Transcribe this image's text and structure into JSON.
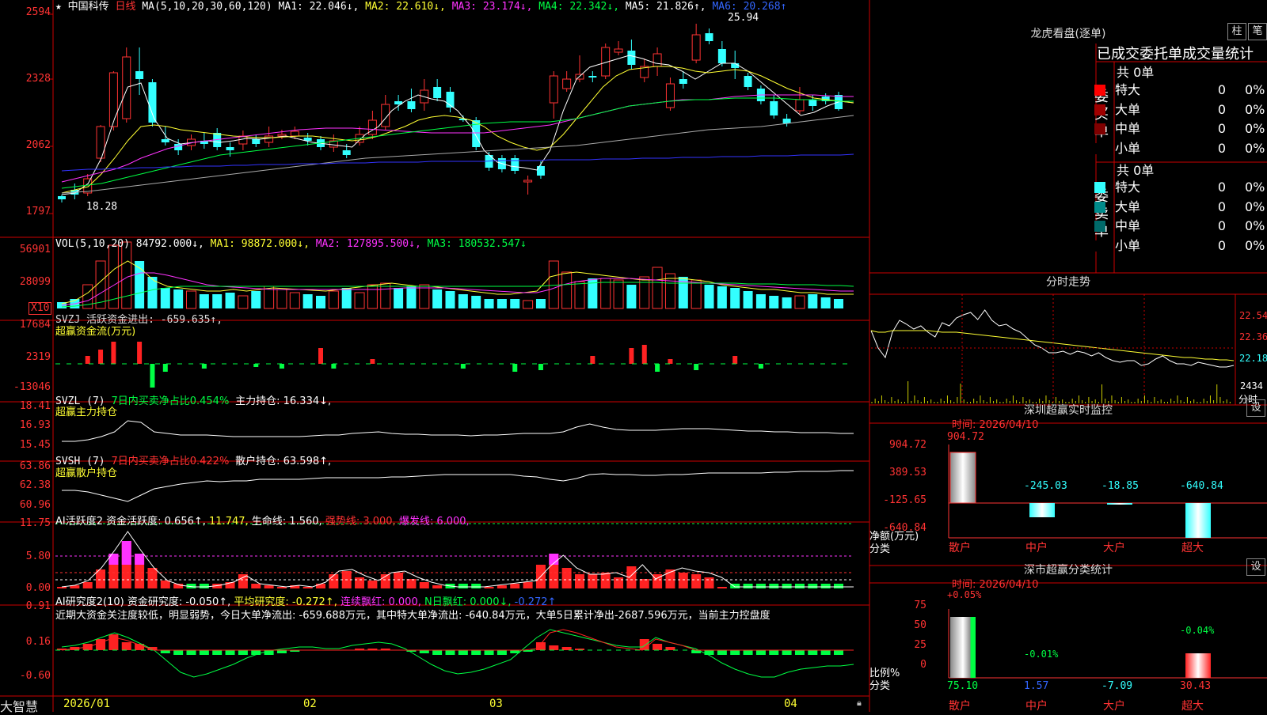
{
  "stock": {
    "name": "中国科传",
    "period": "日线",
    "ma_header": "MA(5,10,20,30,60,120)",
    "ma1": "MA1: 22.046↓,",
    "ma2": "MA2: 22.610↓,",
    "ma3": "MA3: 23.174↓,",
    "ma4": "MA4: 22.342↓,",
    "ma5": "MA5: 21.826↑,",
    "ma6": "MA6: 20.268↑",
    "high_label": "25.94",
    "low_label": "18.28"
  },
  "colors": {
    "red": "#ff3333",
    "cyan": "#33ffff",
    "green": "#00ff44",
    "yellow": "#ffff33",
    "magenta": "#ff33ff",
    "blue": "#3366ff",
    "frame": "#cc0000"
  },
  "price_axis": [
    "2594",
    "2328",
    "2062",
    "1797"
  ],
  "vol": {
    "header": "VOL(5,10,20)",
    "val": "84792.000↓,",
    "ma1": "MA1: 98872.000↓,",
    "ma2": "MA2: 127895.500↓,",
    "ma3": "MA3: 180532.547↓",
    "axis": [
      "56901",
      "28099"
    ],
    "unit": "X10"
  },
  "svzj": {
    "header": "SVZJ  活跃资金进出: -659.635↑,",
    "sub": "超赢资金流(万元)",
    "axis": [
      "17684",
      "2319",
      "-13046"
    ]
  },
  "svzl": {
    "header_a": "SVZL (7)",
    "header_b": "7日内买卖净占比0.454%",
    "header_c": "主力持仓: 16.334↓,",
    "sub": "超赢主力持仓",
    "axis": [
      "18.41",
      "16.93",
      "15.45"
    ]
  },
  "svsh": {
    "header_a": "SVSH (7)",
    "header_b": "7日内买卖净占比0.422%",
    "header_c": "散户持仓: 63.598↑,",
    "sub": "超赢散户持仓",
    "axis": [
      "63.86",
      "62.38",
      "60.96"
    ]
  },
  "ai2": {
    "header_a": "AI活跃度2 资金活跃度: 0.656↑,",
    "header_b": "11.747,",
    "header_c": "生命线: 1.560,",
    "header_d": "强势线: 3.000,",
    "header_e": "爆发线: 6.000,",
    "axis": [
      "11.75",
      "5.80",
      "0.00"
    ]
  },
  "ai_res": {
    "header_a": "AI研究度2(10) 资金研究度: -0.050↑,",
    "header_b": "平均研究度: -0.272↑,",
    "header_c": "连续飘红: 0.000,",
    "header_d": "N日飘红: 0.000↓,",
    "header_e": "-0.272↑",
    "comment": "近期大资金关注度较低，明显弱势，今日大单净流出: -659.688万元，其中特大单净流出: -640.84万元，大单5日累计净出-2687.596万元，当前主力控盘度",
    "axis": [
      "0.91",
      "0.16",
      "-0.60"
    ]
  },
  "dates": [
    "2026/01",
    "02",
    "03",
    "04"
  ],
  "brand": "大智慧",
  "right": {
    "dragon_title": "龙虎看盘(逐单)",
    "btn_bar": "柱",
    "btn_pen": "笔",
    "tab_title": "已成交委托单成交量统计",
    "buy_side": {
      "label": "委买单",
      "total": "共 0单",
      "rows": [
        {
          "name": "特大",
          "v": "0",
          "p": "0%"
        },
        {
          "name": "大单",
          "v": "0",
          "p": "0%"
        },
        {
          "name": "中单",
          "v": "0",
          "p": "0%"
        },
        {
          "name": "小单",
          "v": "0",
          "p": "0%"
        }
      ]
    },
    "sell_side": {
      "label": "委卖单",
      "total": "共 0单",
      "rows": [
        {
          "name": "特大",
          "v": "0",
          "p": "0%"
        },
        {
          "name": "大单",
          "v": "0",
          "p": "0%"
        },
        {
          "name": "中单",
          "v": "0",
          "p": "0%"
        },
        {
          "name": "小单",
          "v": "0",
          "p": "0%"
        }
      ]
    },
    "minute_title": "分时走势",
    "minute_axis": [
      "22.54",
      "22.36",
      "22.18"
    ],
    "minute_vol": "2434",
    "minute_vol_unit": "分时",
    "sz_title": "深圳超赢实时监控",
    "set": "设",
    "sz_time": "时间: 2026/04/10",
    "sz_axis": [
      "904.72",
      "389.53",
      "-125.65",
      "-640.84"
    ],
    "sz_unit_a": "净额(万元)",
    "sz_unit_b": "分类",
    "sz_bars": [
      {
        "cat": "散户",
        "val": "904.72"
      },
      {
        "cat": "中户",
        "val": "-245.03"
      },
      {
        "cat": "大户",
        "val": "-18.85"
      },
      {
        "cat": "超大",
        "val": "-640.84"
      }
    ],
    "cls_title": "深市超赢分类统计",
    "cls_time": "时间: 2026/04/10",
    "cls_axis": [
      "75",
      "50",
      "25",
      "0"
    ],
    "cls_unit_a": "比例%",
    "cls_unit_b": "分类",
    "cls_bars": [
      {
        "cat": "散户",
        "top": "+0.05%",
        "bottom": "75.10"
      },
      {
        "cat": "中户",
        "top": "-0.01%",
        "bottom": "1.57"
      },
      {
        "cat": "大户",
        "top": "",
        "bottom": "-7.09"
      },
      {
        "cat": "超大",
        "top": "-0.04%",
        "bottom": "30.43"
      }
    ]
  }
}
